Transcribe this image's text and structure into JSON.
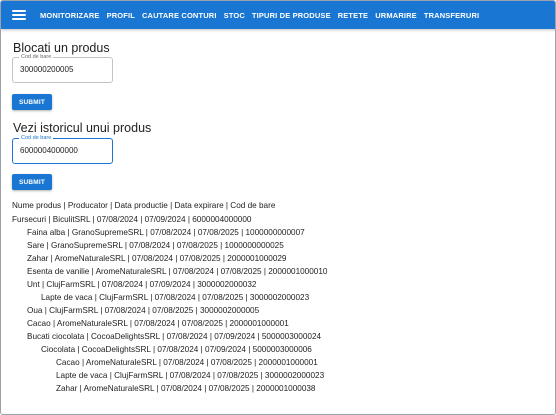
{
  "nav": {
    "items": [
      "MONITORIZARE",
      "PROFIL",
      "CAUTARE CONTURI",
      "STOC",
      "TIPURI DE PRODUSE",
      "RETETE",
      "URMARIRE",
      "TRANSFERURI"
    ]
  },
  "block": {
    "title": "Blocati un produs",
    "field_label": "Cod de bare",
    "field_value": "300000200005",
    "submit_label": "SUBMIT"
  },
  "history": {
    "title": "Vezi istoricul unui produs",
    "field_label": "Cod de bare",
    "field_value": "6000004000000",
    "submit_label": "SUBMIT"
  },
  "list": {
    "header": "Nume produs | Producator | Data productie | Data expirare | Cod de bare",
    "rows": [
      {
        "level": 0,
        "text": "Fursecuri | BiculitSRL | 07/08/2024 | 07/09/2024 | 6000004000000"
      },
      {
        "level": 1,
        "text": "Faina alba | GranoSupremeSRL | 07/08/2024 | 07/08/2025 | 1000000000007"
      },
      {
        "level": 1,
        "text": "Sare | GranoSupremeSRL | 07/08/2024 | 07/08/2025 | 1000000000025"
      },
      {
        "level": 1,
        "text": "Zahar | AromeNaturaleSRL | 07/08/2024 | 07/08/2025 | 2000001000029"
      },
      {
        "level": 1,
        "text": "Esenta de vanilie | AromeNaturaleSRL | 07/08/2024 | 07/08/2025 | 2000001000010"
      },
      {
        "level": 1,
        "text": "Unt | ClujFarmSRL | 07/08/2024 | 07/09/2024 | 3000002000032"
      },
      {
        "level": 2,
        "text": "Lapte de vaca | ClujFarmSRL | 07/08/2024 | 07/08/2025 | 3000002000023"
      },
      {
        "level": 1,
        "text": "Oua | ClujFarmSRL | 07/08/2024 | 07/08/2025 | 3000002000005"
      },
      {
        "level": 1,
        "text": "Cacao | AromeNaturaleSRL | 07/08/2024 | 07/08/2025 | 2000001000001"
      },
      {
        "level": 1,
        "text": "Bucati ciocolata | CocoaDelightsSRL | 07/08/2024 | 07/09/2024 | 5000003000024"
      },
      {
        "level": 2,
        "text": "Ciocolata | CocoaDelightsSRL | 07/08/2024 | 07/09/2024 | 5000003000006"
      },
      {
        "level": 3,
        "text": "Cacao | AromeNaturaleSRL | 07/08/2024 | 07/08/2025 | 2000001000001"
      },
      {
        "level": 3,
        "text": "Lapte de vaca | ClujFarmSRL | 07/08/2024 | 07/08/2025 | 3000002000023"
      },
      {
        "level": 3,
        "text": "Zahar | AromeNaturaleSRL | 07/08/2024 | 07/08/2025 | 2000001000038"
      }
    ]
  }
}
